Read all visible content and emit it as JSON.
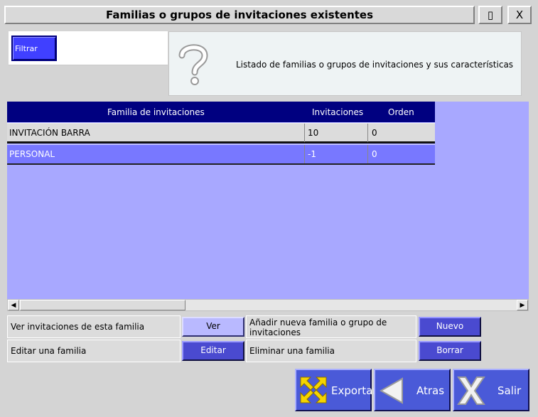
{
  "window": {
    "title": "Familias o grupos de invitaciones existentes",
    "maximize_glyph": "▯",
    "close_glyph": "X"
  },
  "filter": {
    "label": "Filtrar"
  },
  "info": {
    "text": "Listado de familias o grupos de invitaciones y sus características",
    "icon": "question-mark-icon"
  },
  "table": {
    "columns": [
      "Familia de invitaciones",
      "Invitaciones",
      "Orden"
    ],
    "rows": [
      {
        "familia": "INVITACIÓN BARRA",
        "invitaciones": "10",
        "orden": "0",
        "selected": false
      },
      {
        "familia": "PERSONAL",
        "invitaciones": "-1",
        "orden": "0",
        "selected": true
      }
    ]
  },
  "scrollbar": {
    "left_arrow": "◀",
    "right_arrow": "▶"
  },
  "actions": {
    "ver_text": "Ver invitaciones de esta familia",
    "ver_label": "Ver",
    "editar_text": "Editar una familia",
    "editar_label": "Editar",
    "nuevo_text": "Añadir nueva familia o grupo de invitaciones",
    "nuevo_label": "Nuevo",
    "borrar_text": "Eliminar una familia",
    "borrar_label": "Borrar"
  },
  "footer": {
    "exportar_label": "Exportar",
    "atras_label": "Atras",
    "salir_label": "Salir"
  },
  "colors": {
    "header_bg": "#000080",
    "grid_bg": "#a8a8ff",
    "selected_row": "#7878ff",
    "button_blue": "#4a5ad8"
  }
}
